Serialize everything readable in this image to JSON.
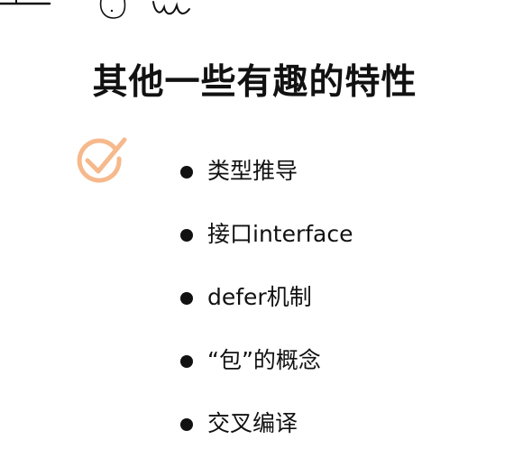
{
  "slide": {
    "title": "其他一些有趣的特性",
    "accent_color": "#f6b98c",
    "decorations": [
      "hand-drawn-doodle",
      "check-circle-icon"
    ]
  },
  "features": [
    {
      "label": "类型推导"
    },
    {
      "label": "接口interface"
    },
    {
      "label": "defer机制"
    },
    {
      "label": "“包”的概念"
    },
    {
      "label": "交叉编译"
    }
  ]
}
